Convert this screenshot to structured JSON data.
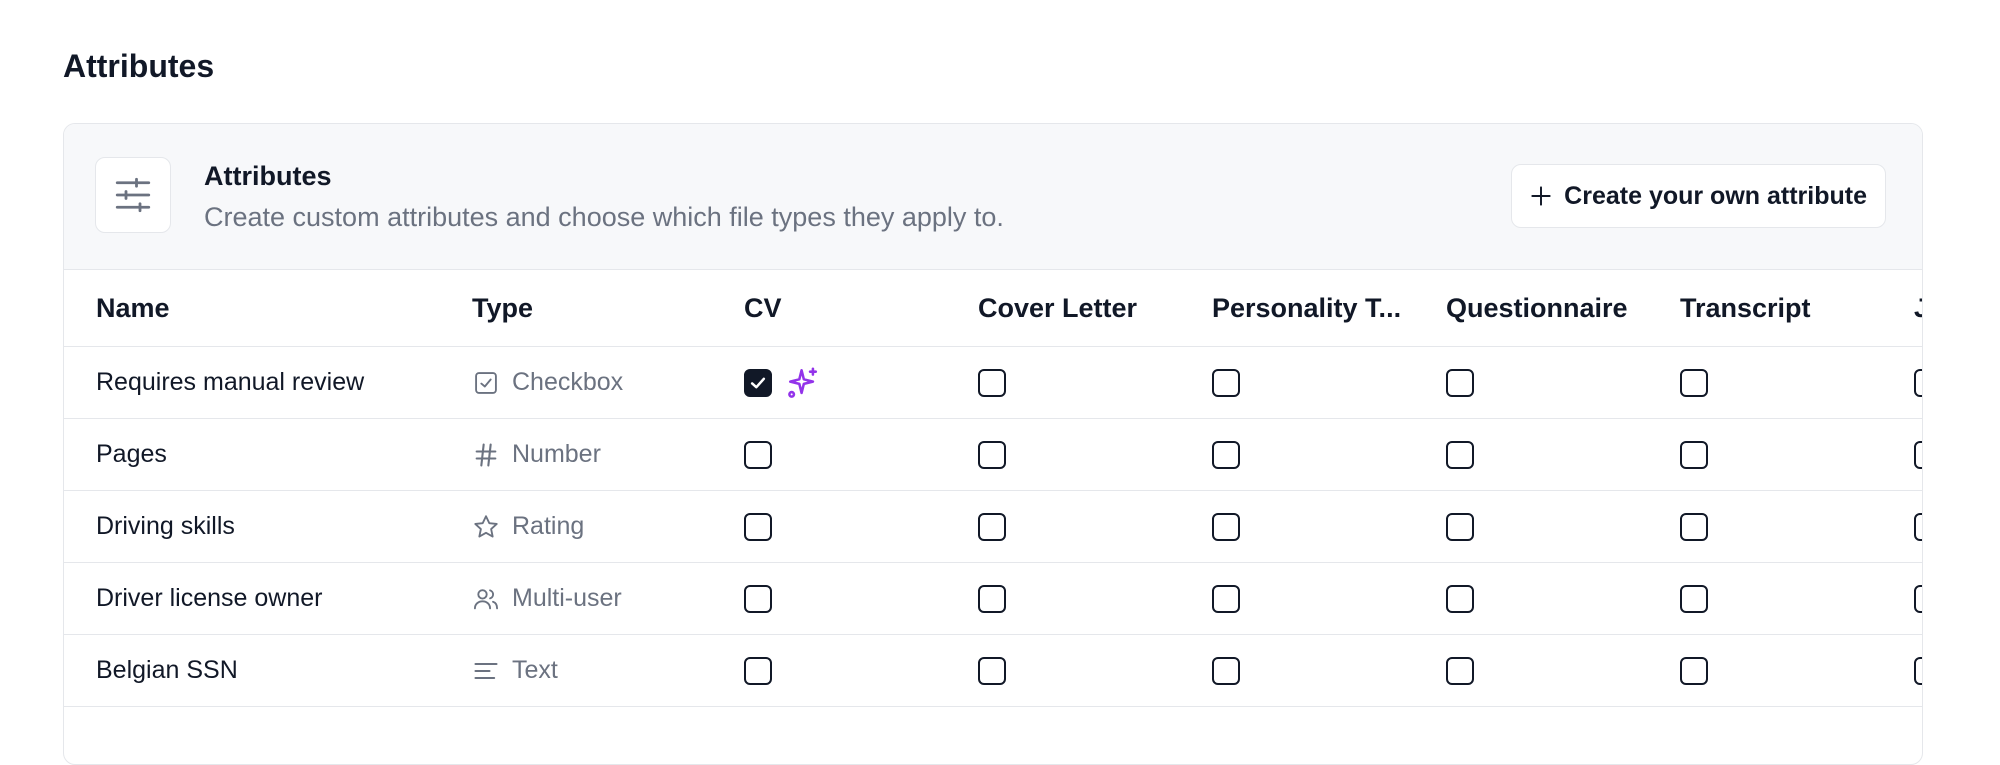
{
  "page": {
    "title": "Attributes"
  },
  "header": {
    "title": "Attributes",
    "subtitle": "Create custom attributes and choose which file types they apply to.",
    "create_button": "Create your own attribute",
    "icon": "sliders-icon"
  },
  "table": {
    "columns": [
      "Name",
      "Type",
      "CV",
      "Cover Letter",
      "Personality T...",
      "Questionnaire",
      "Transcript",
      "Jo"
    ],
    "rows": [
      {
        "name": "Requires manual review",
        "type": "Checkbox",
        "type_icon": "checkbox-icon",
        "checks": [
          true,
          false,
          false,
          false,
          false,
          false
        ],
        "ai_suggested": true
      },
      {
        "name": "Pages",
        "type": "Number",
        "type_icon": "hash-icon",
        "checks": [
          false,
          false,
          false,
          false,
          false,
          false
        ]
      },
      {
        "name": "Driving skills",
        "type": "Rating",
        "type_icon": "star-icon",
        "checks": [
          false,
          false,
          false,
          false,
          false,
          false
        ]
      },
      {
        "name": "Driver license owner",
        "type": "Multi-user",
        "type_icon": "users-icon",
        "checks": [
          false,
          false,
          false,
          false,
          false,
          false
        ]
      },
      {
        "name": "Belgian SSN",
        "type": "Text",
        "type_icon": "text-lines-icon",
        "checks": [
          false,
          false,
          false,
          false,
          false,
          false
        ]
      }
    ]
  },
  "colors": {
    "accent": "#111827",
    "sparkle": "#9333ea",
    "muted": "#6b7280",
    "border": "#e5e7eb",
    "header_bg": "#f7f8fa"
  }
}
